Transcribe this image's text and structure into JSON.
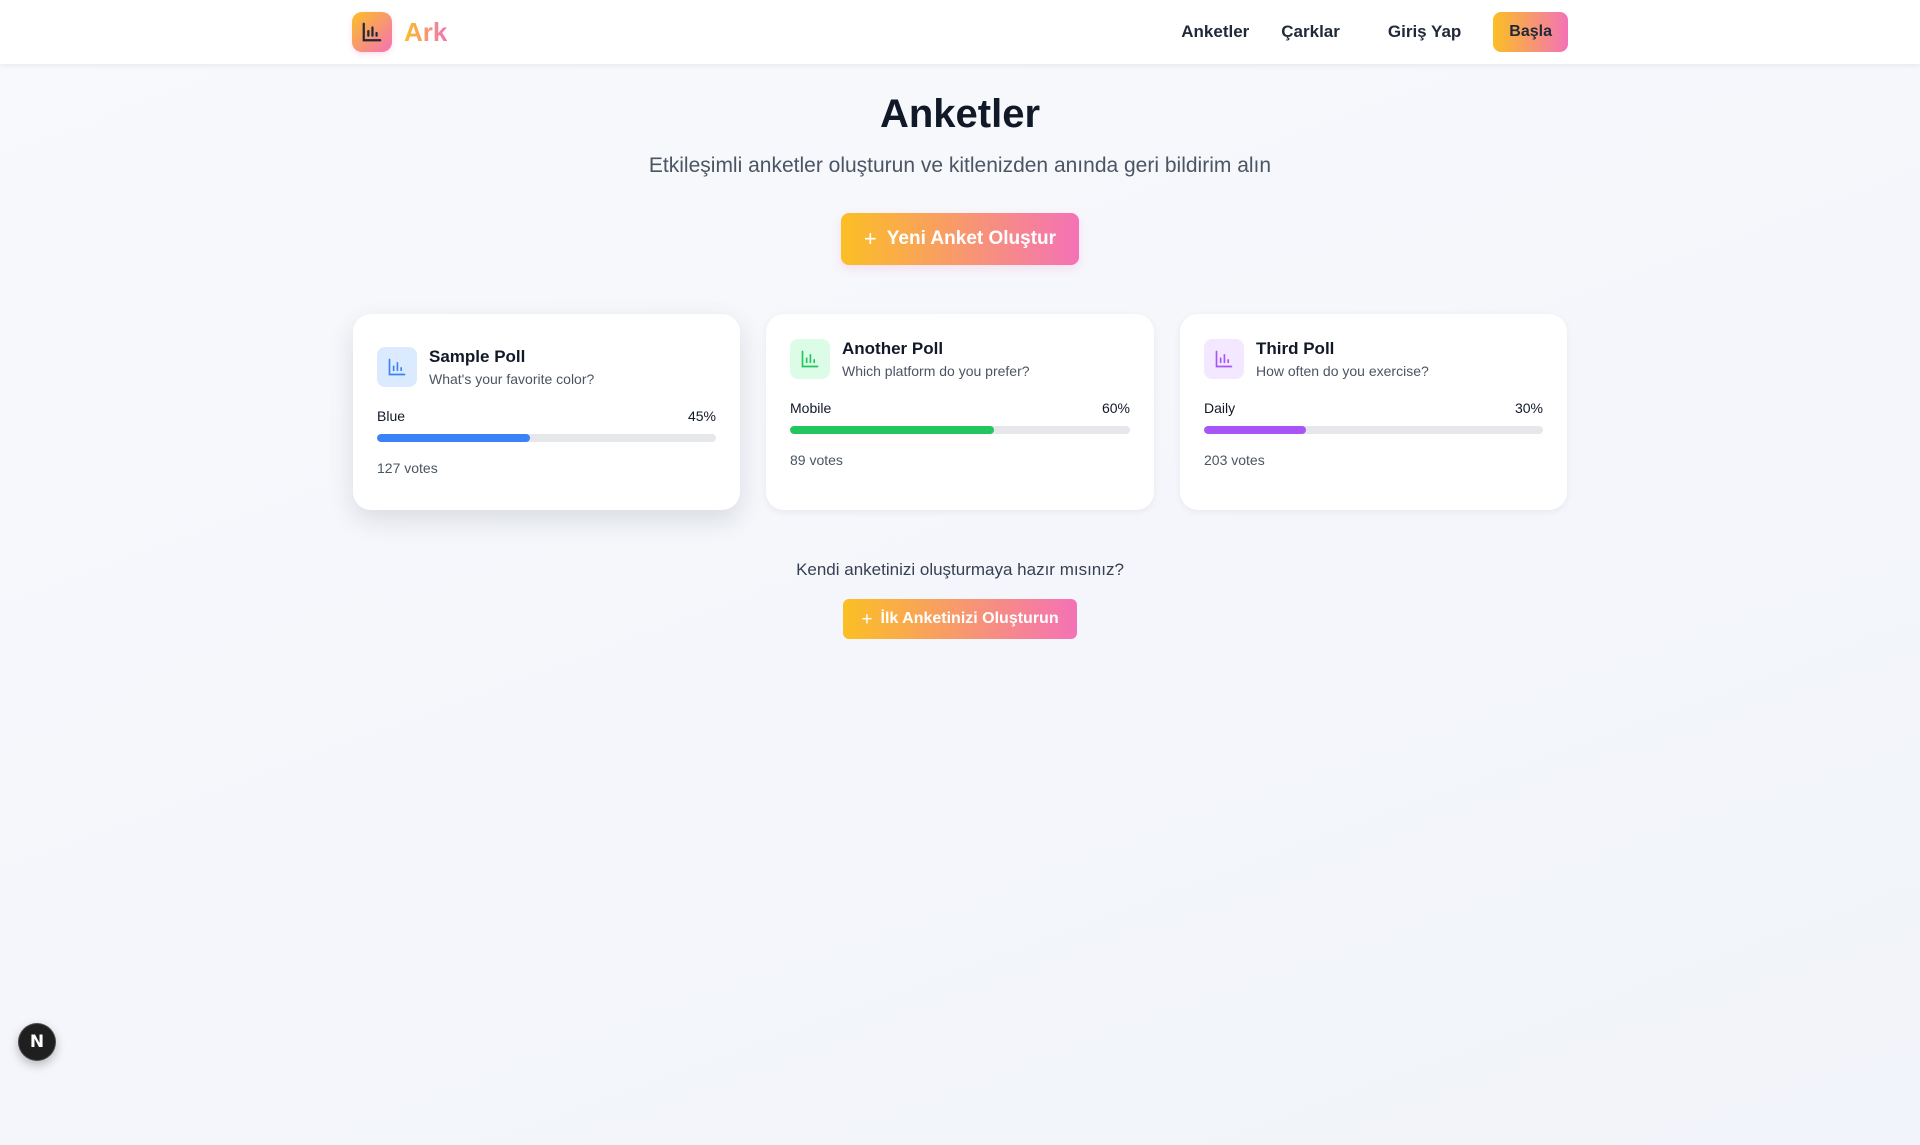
{
  "header": {
    "brand": "Ark",
    "nav": {
      "polls": "Anketler",
      "wheels": "Çarklar",
      "login": "Giriş Yap",
      "start": "Başla"
    }
  },
  "hero": {
    "title": "Anketler",
    "subtitle": "Etkileşimli anketler oluşturun ve kitlenizden anında geri bildirim alın",
    "create_button": "Yeni Anket Oluştur"
  },
  "polls": [
    {
      "title": "Sample Poll",
      "question": "What's your favorite color?",
      "option": "Blue",
      "percent_label": "45%",
      "percent": 45,
      "votes": "127 votes",
      "color": "#3b82f6",
      "icon_bg": "#dbeafe"
    },
    {
      "title": "Another Poll",
      "question": "Which platform do you prefer?",
      "option": "Mobile",
      "percent_label": "60%",
      "percent": 60,
      "votes": "89 votes",
      "color": "#22c55e",
      "icon_bg": "#dcfce7"
    },
    {
      "title": "Third Poll",
      "question": "How often do you exercise?",
      "option": "Daily",
      "percent_label": "30%",
      "percent": 30,
      "votes": "203 votes",
      "color": "#a855f7",
      "icon_bg": "#f3e8ff"
    }
  ],
  "cta": {
    "text": "Kendi anketinizi oluşturmaya hazır mısınız?",
    "button": "İlk Anketinizi Oluşturun"
  },
  "dev_badge": "N",
  "icons": {
    "brand": "bar-chart-icon",
    "poll": "bar-chart-icon",
    "add": "plus-icon"
  }
}
